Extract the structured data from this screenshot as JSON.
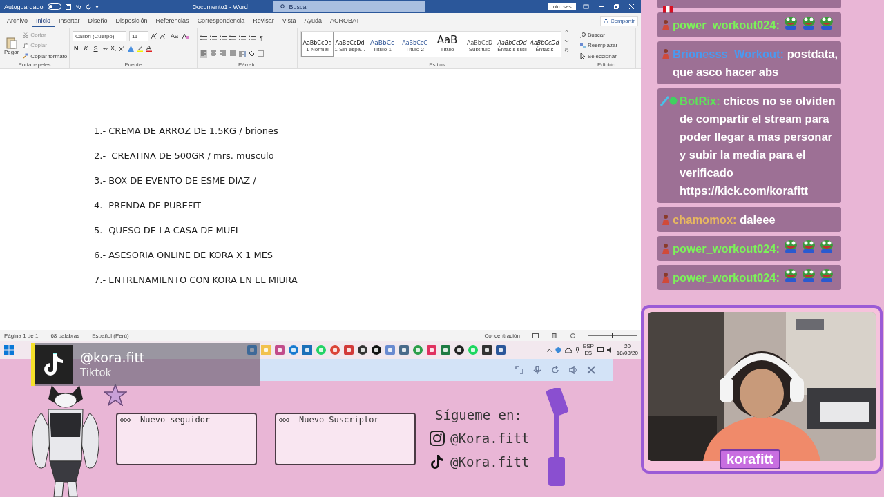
{
  "window": {
    "autosave_label": "Autoguardado",
    "autosave_on": false,
    "title": "Documento1 - Word",
    "search": {
      "placeholder": "Buscar"
    },
    "sign_in": "Inic. ses."
  },
  "ribbon": {
    "tabs": [
      {
        "label": "Archivo",
        "selected": false
      },
      {
        "label": "Inicio",
        "selected": true
      },
      {
        "label": "Insertar",
        "selected": false
      },
      {
        "label": "Diseño",
        "selected": false
      },
      {
        "label": "Disposición",
        "selected": false
      },
      {
        "label": "Referencias",
        "selected": false
      },
      {
        "label": "Correspondencia",
        "selected": false
      },
      {
        "label": "Revisar",
        "selected": false
      },
      {
        "label": "Vista",
        "selected": false
      },
      {
        "label": "Ayuda",
        "selected": false
      },
      {
        "label": "ACROBAT",
        "selected": false
      }
    ],
    "share": "Compartir",
    "clipboard": {
      "label": "Portapapeles",
      "paste": "Pegar",
      "items": [
        {
          "label": "Cortar",
          "disabled": true
        },
        {
          "label": "Copiar",
          "disabled": true
        },
        {
          "label": "Copiar formato",
          "disabled": false
        }
      ]
    },
    "font": {
      "label": "Fuente",
      "font_name": "Calibri (Cuerpo)",
      "font_size": "11",
      "case": "Aa",
      "format_buttons": [
        "N",
        "K",
        "S"
      ]
    },
    "paragraph": {
      "label": "Párrafo",
      "pilcrow": "¶",
      "align_buttons": [
        {
          "kind": "left",
          "selected": true
        },
        {
          "kind": "center",
          "selected": false
        },
        {
          "kind": "right",
          "selected": false
        },
        {
          "kind": "justify",
          "selected": false
        }
      ]
    },
    "styles": {
      "label": "Estilos",
      "items": [
        {
          "preview": "AaBbCcDd",
          "name": "1 Normal",
          "kind": "normal",
          "selected": true
        },
        {
          "preview": "AaBbCcDd",
          "name": "1 Sin espa...",
          "kind": "normal",
          "selected": false
        },
        {
          "preview": "AaBbCc",
          "name": "Título 1",
          "kind": "heading1",
          "selected": false
        },
        {
          "preview": "AaBbCcC",
          "name": "Título 2",
          "kind": "heading2",
          "selected": false
        },
        {
          "preview": "AaB",
          "name": "Título",
          "kind": "title",
          "selected": false
        },
        {
          "preview": "AaBbCcD",
          "name": "Subtítulo",
          "kind": "subtitle",
          "selected": false
        },
        {
          "preview": "AaBbCcDd",
          "name": "Énfasis sutil",
          "kind": "emphasis",
          "selected": false
        },
        {
          "preview": "AaBbCcDd",
          "name": "Énfasis",
          "kind": "emphasis",
          "selected": false
        }
      ]
    },
    "editing": {
      "label": "Edición",
      "items": [
        "Buscar",
        "Reemplazar",
        "Seleccionar"
      ]
    }
  },
  "document": {
    "lines": [
      "1.- CREMA DE ARROZ DE 1.5KG / briones",
      "2.-  CREATINA DE 500GR / mrs. musculo",
      "3.- BOX DE EVENTO DE ESME DIAZ /",
      "4.- PRENDA DE PUREFIT",
      "5.- QUESO DE LA CASA DE MUFI",
      "6.- ASESORIA ONLINE DE KORA X 1 MES",
      "7.- ENTRENAMIENTO CON KORA EN EL MIURA"
    ]
  },
  "status_bar": {
    "items": [
      "Página 1 de 1",
      "68 palabras",
      "Español (Perú)"
    ],
    "focus": "Concentración",
    "zoom": {
      "level": 0.5
    }
  },
  "taskbar": {
    "language": "ESP",
    "layout": "ES",
    "time": "20",
    "date": "18/08/20"
  },
  "tiktok_popup": {
    "handle": "@kora.fitt",
    "platform": "Tiktok"
  },
  "alerts": [
    "Nuevo seguidor",
    "Nuevo Suscriptor"
  ],
  "follow": {
    "title": "Sígueme en:",
    "accounts": [
      {
        "kind": "instagram",
        "handle": "@Kora.fitt"
      },
      {
        "kind": "tiktok",
        "handle": "@Kora.fitt"
      }
    ]
  },
  "chat": {
    "messages": [
      {
        "kind": "flag"
      },
      {
        "kind": "emotes",
        "badge": {
          "kind": "user"
        },
        "user": "power_workout024:",
        "color": "#7cf25a"
      },
      {
        "kind": "text",
        "badge": {
          "kind": "user"
        },
        "user": "Brionesss_Workout:",
        "color": "#4a9af0",
        "text": "postdata, que asco hacer abs"
      },
      {
        "kind": "text",
        "badge": {
          "kind": "bot"
        },
        "user": "BotRix:",
        "color": "#5ee25a",
        "text": "chicos no se olviden de compartir el stream para poder llegar a mas personar y subir la media para el verificado https://kick.com/korafitt"
      },
      {
        "kind": "text",
        "badge": {
          "kind": "user"
        },
        "user": "chamomox:",
        "color": "#e8b860",
        "text": "daleee"
      },
      {
        "kind": "emotes",
        "badge": {
          "kind": "user"
        },
        "user": "power_workout024:",
        "color": "#7cf25a"
      },
      {
        "kind": "emotes",
        "badge": {
          "kind": "user"
        },
        "user": "power_workout024:",
        "color": "#7cf25a"
      }
    ]
  },
  "webcam": {
    "label": "korafitt"
  }
}
